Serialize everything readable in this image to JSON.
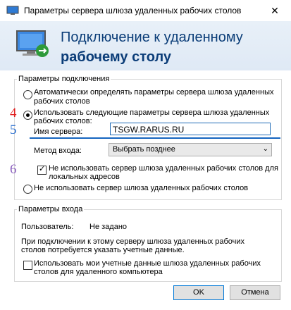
{
  "window": {
    "title": "Параметры сервера шлюза удаленных рабочих столов",
    "close_glyph": "✕"
  },
  "banner": {
    "line1": "Подключение к удаленному",
    "line2": "рабочему столу"
  },
  "connection": {
    "legend": "Параметры подключения",
    "auto_line1": "Автоматически определять параметры сервера шлюза удаленных",
    "auto_line2": "рабочих столов",
    "use_line1": "Использовать следующие параметры сервера шлюза удаленных",
    "use_line2": "рабочих столов:",
    "server_label": "Имя сервера:",
    "server_value": "TSGW.RARUS.RU",
    "logon_label": "Метод входа:",
    "logon_value": "Выбрать позднее",
    "bypass_line1": "Не использовать сервер шлюза удаленных рабочих столов для",
    "bypass_line2": "локальных адресов",
    "none_label": "Не использовать сервер шлюза удаленных рабочих столов"
  },
  "logon": {
    "legend": "Параметры входа",
    "user_label": "Пользователь:",
    "user_value": "Не задано",
    "info_line1": "При подключении к этому серверу шлюза удаленных рабочих",
    "info_line2": "столов потребуется указать учетные данные.",
    "reuse_line1": "Использовать мои учетные данные шлюза удаленных рабочих",
    "reuse_line2": "столов для удаленного компьютера"
  },
  "buttons": {
    "ok": "OK",
    "cancel": "Отмена"
  },
  "annotations": {
    "n4": "4",
    "n5": "5",
    "n6": "6"
  },
  "colors": {
    "annot4": "#e02020",
    "annot5": "#2a6fd0",
    "annot6": "#8b5fbf",
    "heading": "#0b3d78"
  }
}
